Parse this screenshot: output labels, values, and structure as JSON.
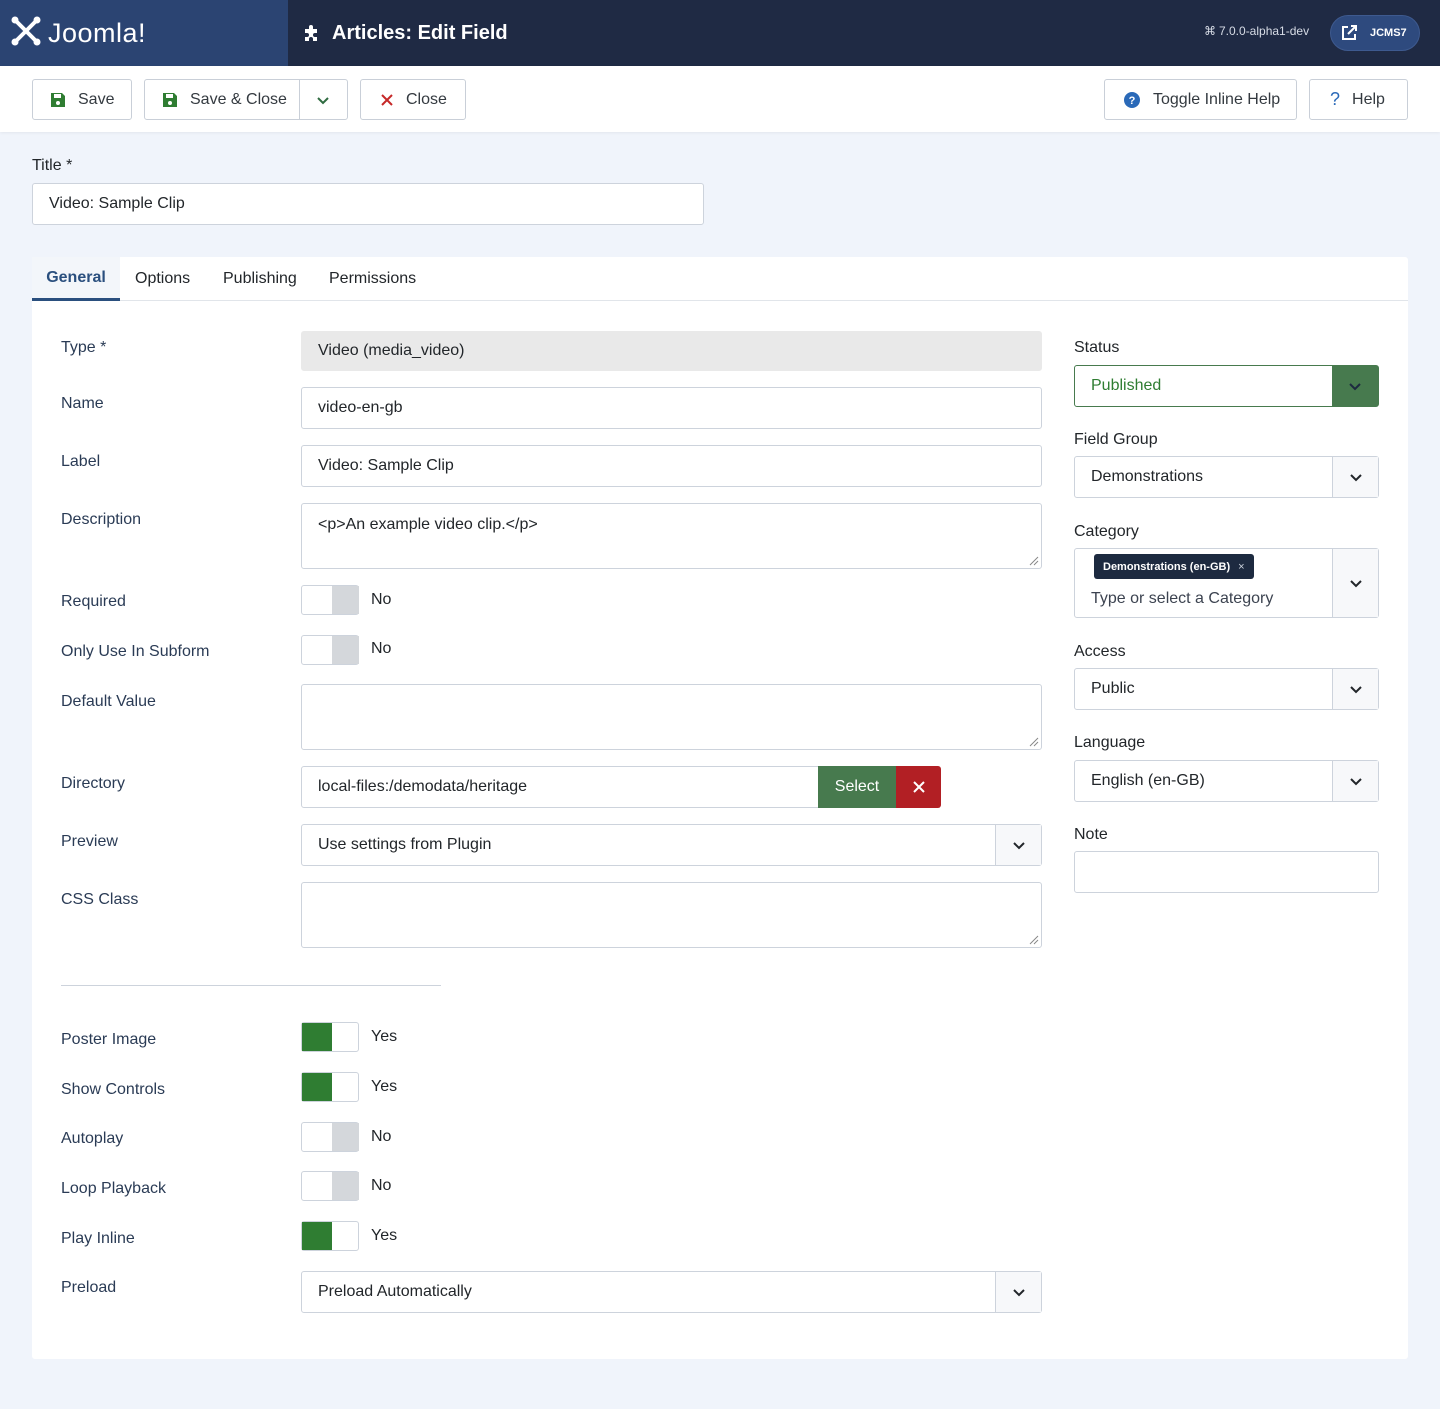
{
  "header": {
    "logo_text": "Joomla!",
    "page_title": "Articles: Edit Field",
    "version": "7.0.0-alpha1-dev",
    "site_label": "JCMS7"
  },
  "toolbar": {
    "save_label": "Save",
    "save_close_label": "Save & Close",
    "close_label": "Close",
    "toggle_inline_help_label": "Toggle Inline Help",
    "help_label": "Help"
  },
  "title_field": {
    "label": "Title *",
    "value": "Video: Sample Clip"
  },
  "tabs": [
    {
      "label": "General",
      "active": true
    },
    {
      "label": "Options",
      "active": false
    },
    {
      "label": "Publishing",
      "active": false
    },
    {
      "label": "Permissions",
      "active": false
    }
  ],
  "general": {
    "type": {
      "label": "Type *",
      "value": "Video (media_video)"
    },
    "name": {
      "label": "Name",
      "value": "video-en-gb"
    },
    "label": {
      "label": "Label",
      "value": "Video: Sample Clip"
    },
    "description": {
      "label": "Description",
      "value": "<p>An example video clip.</p>"
    },
    "required": {
      "label": "Required",
      "value": "No"
    },
    "only_subform": {
      "label": "Only Use In Subform",
      "value": "No"
    },
    "default_value": {
      "label": "Default Value",
      "value": ""
    },
    "directory": {
      "label": "Directory",
      "value": "local-files:/demodata/heritage",
      "select_label": "Select"
    },
    "preview": {
      "label": "Preview",
      "value": "Use settings from Plugin"
    },
    "css_class": {
      "label": "CSS Class",
      "value": ""
    },
    "poster_image": {
      "label": "Poster Image",
      "value": "Yes"
    },
    "show_controls": {
      "label": "Show Controls",
      "value": "Yes"
    },
    "autoplay": {
      "label": "Autoplay",
      "value": "No"
    },
    "loop_playback": {
      "label": "Loop Playback",
      "value": "No"
    },
    "play_inline": {
      "label": "Play Inline",
      "value": "Yes"
    },
    "preload": {
      "label": "Preload",
      "value": "Preload Automatically"
    }
  },
  "sidebar": {
    "status": {
      "label": "Status",
      "value": "Published"
    },
    "field_group": {
      "label": "Field Group",
      "value": "Demonstrations"
    },
    "category": {
      "label": "Category",
      "chip": "Demonstrations (en-GB)",
      "chip_remove": "×",
      "placeholder": "Type or select a Category"
    },
    "access": {
      "label": "Access",
      "value": "Public"
    },
    "language": {
      "label": "Language",
      "value": "English (en-GB)"
    },
    "note": {
      "label": "Note",
      "value": ""
    }
  },
  "colors": {
    "header_bg": "#1f2a44",
    "logo_bg": "#2b4472",
    "success": "#477a4e",
    "danger": "#b21f24",
    "tab_active": "#2a4f7e"
  }
}
